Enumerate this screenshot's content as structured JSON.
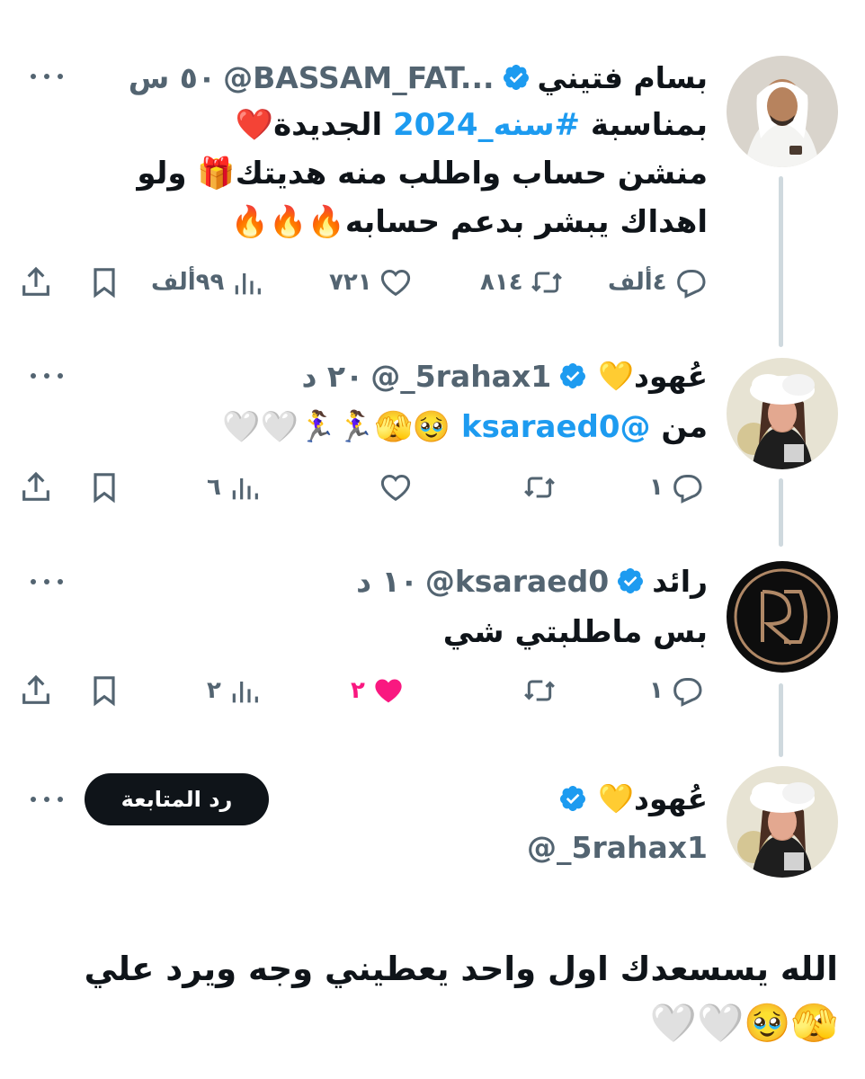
{
  "colors": {
    "accent": "#1d9bf0",
    "muted": "#536471",
    "like": "#f91880",
    "text": "#0f1419",
    "line": "#cfd9de"
  },
  "tweets": [
    {
      "name": "بسام فتيني",
      "handle": "@BASSAM_FAT...",
      "time": "٥٠ س",
      "body": {
        "line1_pre": "بمناسبة ",
        "hashtag": "#سنه_2024",
        "line1_post": " الجديدة❤️",
        "line2": "منشن حساب واطلب منه هديتك🎁 ولو",
        "line3": "اهداك يبشر بدعم حسابه🔥🔥🔥"
      },
      "actions": {
        "replies": "٤ألف",
        "retweets": "٨١٤",
        "likes": "٧٢١",
        "views": "٩٩ألف"
      }
    },
    {
      "name": "عُهود",
      "name_emoji": "💛",
      "handle": "@_5rahax1",
      "time": "٢٠ د",
      "body": {
        "prefix": "من ",
        "mention": "@ksaraed0",
        "emojis": " 🥹🫣🏃‍♀️🏃‍♀️🤍🤍"
      },
      "actions": {
        "replies": "١",
        "retweets": "",
        "likes": "",
        "views": "٦"
      }
    },
    {
      "name": "رائد",
      "handle": "@ksaraed0",
      "time": "١٠ د",
      "body": {
        "text": "بس ماطلبتي شي"
      },
      "actions": {
        "replies": "١",
        "retweets": "",
        "likes": "٢",
        "views": "٢"
      }
    },
    {
      "name": "عُهود",
      "name_emoji": "💛",
      "handle": "@_5rahax1",
      "follow_label": "رد المتابعة",
      "body": {
        "line1": "الله يسسعدك اول واحد يعطيني وجه ويرد علي",
        "line2": "🫣🥹🤍🤍"
      }
    }
  ],
  "icons": {
    "reply": "reply-icon",
    "retweet": "retweet-icon",
    "like": "heart-icon",
    "views": "views-icon",
    "bookmark": "bookmark-icon",
    "share": "share-icon",
    "verified": "verified-badge-icon",
    "more": "more-icon"
  }
}
